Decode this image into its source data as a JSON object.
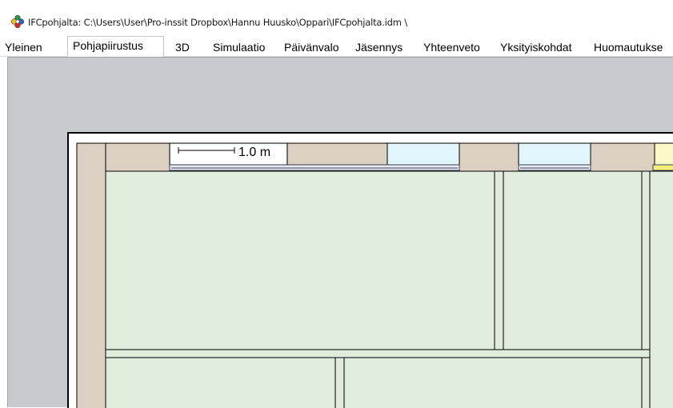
{
  "window": {
    "title": "IFCpohjalta: C:\\Users\\User\\Pro-inssit Dropbox\\Hannu Huusko\\Oppari\\IFCpohjalta.idm \\",
    "icon": "app-multicolor-icon"
  },
  "tabs": [
    {
      "label": "Yleinen",
      "active": false
    },
    {
      "label": "Pohjapiirustus",
      "active": true
    },
    {
      "label": "3D",
      "active": false
    },
    {
      "label": "Simulaatio",
      "active": false
    },
    {
      "label": "Päivänvalo",
      "active": false
    },
    {
      "label": "Jäsennys",
      "active": false
    },
    {
      "label": "Yhteenveto",
      "active": false
    },
    {
      "label": "Yksityiskohdat",
      "active": false
    },
    {
      "label": "Huomautukse",
      "active": false
    }
  ],
  "floorplan": {
    "scale_label": "1.0 m",
    "colors": {
      "background": "#c7cbcf",
      "sheet": "#ffffff",
      "wall": "#dcd0c2",
      "room": "#e0ecdc",
      "window": "#e1f6fb",
      "door": "#fbf9c6",
      "outline": "#000000"
    }
  }
}
